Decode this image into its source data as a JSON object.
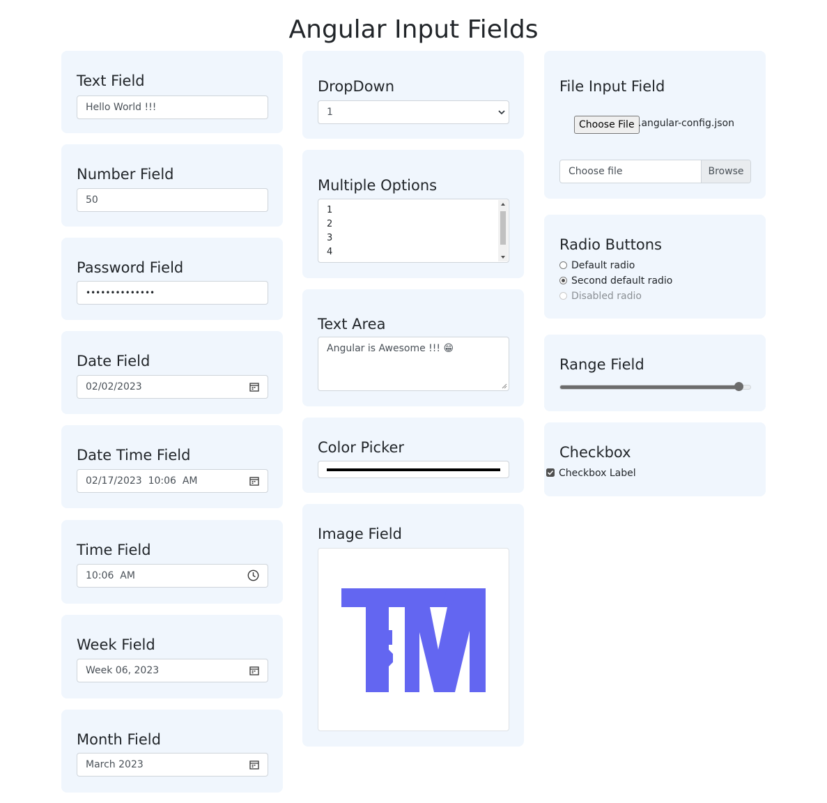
{
  "page_title": "Angular Input Fields",
  "text_field": {
    "label": "Text Field",
    "value": "Hello World !!!"
  },
  "number_field": {
    "label": "Number Field",
    "value": "50"
  },
  "password_field": {
    "label": "Password Field",
    "masked": "••••••••••••••"
  },
  "date_field": {
    "label": "Date Field",
    "value": "02/02/2023",
    "icon": "calendar-icon"
  },
  "datetime_field": {
    "label": "Date Time Field",
    "value": "02/17/2023  10:06  AM",
    "icon": "calendar-icon"
  },
  "time_field": {
    "label": "Time Field",
    "value": "10:06  AM",
    "icon": "clock-icon"
  },
  "week_field": {
    "label": "Week Field",
    "value": "Week 06, 2023",
    "icon": "calendar-icon"
  },
  "month_field": {
    "label": "Month Field",
    "value": "March 2023",
    "icon": "calendar-icon"
  },
  "dropdown": {
    "label": "DropDown",
    "selected": "1"
  },
  "multiple_options": {
    "label": "Multiple Options",
    "options": [
      "1",
      "2",
      "3",
      "4"
    ]
  },
  "text_area": {
    "label": "Text Area",
    "value": "Angular is Awesome !!! 😁"
  },
  "color_picker": {
    "label": "Color Picker",
    "value": "#000000"
  },
  "image_field": {
    "label": "Image Field",
    "logo_text": "TM",
    "logo_color": "#6366f1"
  },
  "file_input": {
    "label": "File Input Field",
    "choose_button": "Choose File",
    "file_name": ".angular-config.json",
    "custom_placeholder": "Choose file",
    "browse_button": "Browse"
  },
  "radio_buttons": {
    "label": "Radio Buttons",
    "options": [
      {
        "label": "Default radio",
        "checked": false,
        "disabled": false
      },
      {
        "label": "Second default radio",
        "checked": true,
        "disabled": false
      },
      {
        "label": "Disabled radio",
        "checked": false,
        "disabled": true
      }
    ]
  },
  "range_field": {
    "label": "Range Field",
    "value_fraction": 0.94
  },
  "checkbox": {
    "label": "Checkbox",
    "option_label": "Checkbox Label",
    "checked": true
  }
}
